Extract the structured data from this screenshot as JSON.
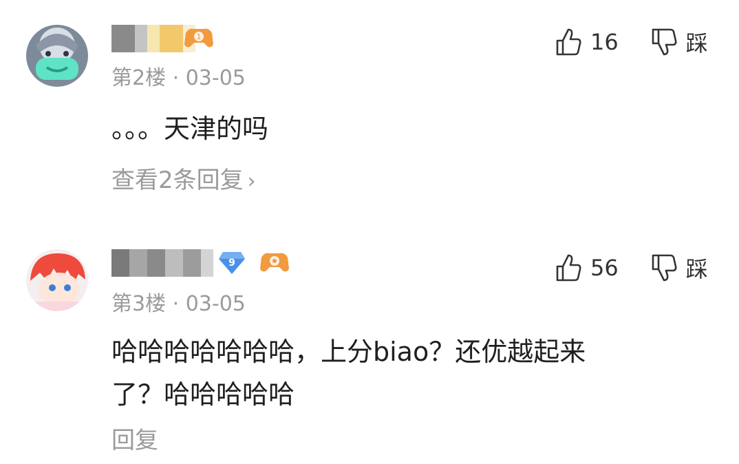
{
  "comments": [
    {
      "floor_date": "第2楼 · 03-05",
      "likes": "16",
      "dislike_label": "踩",
      "text": "。。。天津的吗",
      "reply_link": "查看2条回复",
      "level_badge": "1",
      "avatar_icon": "avatar-masked-character"
    },
    {
      "floor_date": "第3楼 · 03-05",
      "likes": "56",
      "dislike_label": "踩",
      "text_line1": "哈哈哈哈哈哈哈，上分biao？还优越起来",
      "text_line2": "了？哈哈哈哈哈",
      "reply_link": "回复",
      "level_badge": "9",
      "avatar_icon": "avatar-red-hair-character"
    }
  ],
  "colors": {
    "meta_gray": "#9a9a9a",
    "badge_orange": "#f29a3e",
    "badge_blue": "#4a8fe8"
  }
}
